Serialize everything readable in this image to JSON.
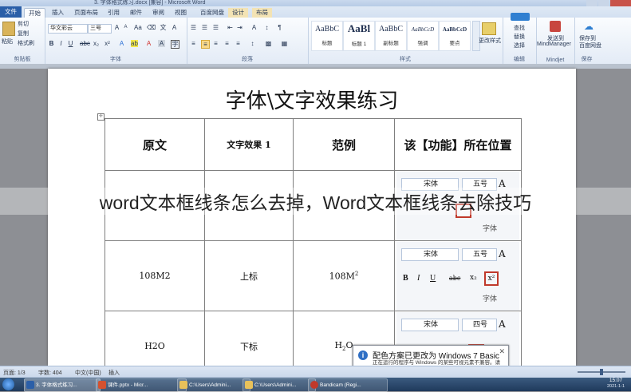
{
  "window": {
    "title": "3. 字体格式练习.docx [兼容] - Microsoft Word"
  },
  "tabs": [
    "文件",
    "开始",
    "插入",
    "页面布局",
    "引用",
    "邮件",
    "审阅",
    "视图",
    "百度网盘",
    "设计",
    "布局"
  ],
  "ribbon": {
    "clipboard": {
      "paste": "粘贴",
      "cut": "剪切",
      "copy": "复制",
      "format_painter": "格式刷",
      "label": "剪贴板"
    },
    "font": {
      "name": "华文彩云",
      "size": "三号",
      "label": "字体"
    },
    "paragraph": {
      "label": "段落"
    },
    "styles": {
      "items": [
        {
          "sample": "AaBbC",
          "name": "标题"
        },
        {
          "sample": "AaBl",
          "name": "标题 1"
        },
        {
          "sample": "AaBbC",
          "name": "副标题"
        },
        {
          "sample": "AaBbCcD",
          "name": "强调"
        },
        {
          "sample": "AaBbCcD",
          "name": "要点"
        }
      ],
      "change": "更改样式",
      "label": "样式"
    },
    "editing": {
      "find": "查找",
      "replace": "替换",
      "select": "选择",
      "label": "编辑"
    },
    "mindjet": {
      "send": "发送到",
      "product": "MindManager",
      "label": "Mindjet"
    },
    "save": {
      "a": "保存到",
      "b": "百度网盘",
      "label": "保存"
    }
  },
  "document": {
    "title": "字体\\文字效果练习",
    "table": {
      "headers": [
        "原文",
        "文字效果 1",
        "范例",
        "该【功能】所在位置"
      ],
      "rows": [
        {
          "original": "",
          "effect": "",
          "example": "",
          "panel": {
            "font": "宋体",
            "size": "五号",
            "group": "字体"
          }
        },
        {
          "original": "108M2",
          "effect": "上标",
          "example": "108M",
          "example_sup": "2",
          "panel": {
            "font": "宋体",
            "size": "五号",
            "group": "字体"
          }
        },
        {
          "original": "H2O",
          "effect": "下标",
          "example": "H",
          "example_sub": "2",
          "example_tail": "O",
          "panel": {
            "font": "宋体",
            "size": "四号",
            "group": ""
          }
        }
      ]
    }
  },
  "caption": "word文本框线条怎么去掉，Word文本框线条去除技巧",
  "notification": {
    "title": "配色方案已更改为 Windows 7 Basic",
    "body": "正在运行的程序与 Windows 的某些可视元素不兼容。请单击此处获取详细信息。"
  },
  "status": {
    "page": "页面: 1/3",
    "words": "字数: 404",
    "lang": "中文(中国)",
    "mode": "插入"
  },
  "taskbar": {
    "items": [
      "3. 字体格式练习...",
      "课件.pptx - Micr...",
      "C:\\Users\\Admini...",
      "C:\\Users\\Admini...",
      "Bandicam (Regi..."
    ],
    "time": "15:07",
    "date": "2021-1-1"
  }
}
